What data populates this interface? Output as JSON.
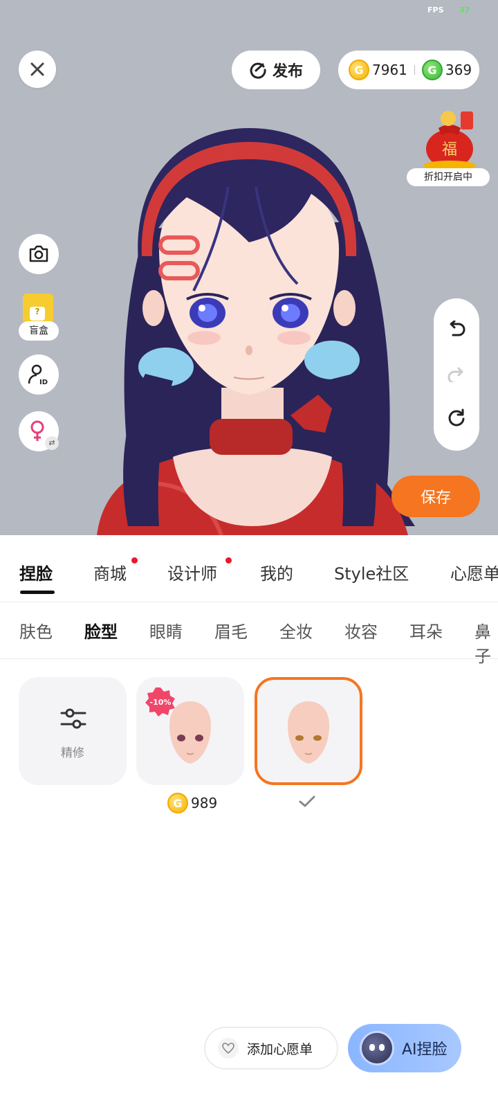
{
  "status": {
    "fps_label": "FPS",
    "fps_value": "37"
  },
  "header": {
    "publish_label": "发布",
    "gold_amount": "7961",
    "green_amount": "369",
    "gold_coin_symbol": "G",
    "green_coin_symbol": "G"
  },
  "promo": {
    "label": "折扣开启中",
    "bag_character": "福"
  },
  "sidebar": {
    "blindbox_label": "盲盒",
    "blindbox_symbol": "?"
  },
  "actions": {
    "save_label": "保存"
  },
  "main_tabs": [
    {
      "label": "捏脸",
      "active": true,
      "dot": false
    },
    {
      "label": "商城",
      "active": false,
      "dot": true
    },
    {
      "label": "设计师",
      "active": false,
      "dot": true
    },
    {
      "label": "我的",
      "active": false,
      "dot": false
    },
    {
      "label": "Style社区",
      "active": false,
      "dot": false
    },
    {
      "label": "心愿单",
      "active": false,
      "dot": false
    }
  ],
  "sub_tabs": [
    {
      "label": "肤色",
      "active": false
    },
    {
      "label": "脸型",
      "active": true
    },
    {
      "label": "眼睛",
      "active": false
    },
    {
      "label": "眉毛",
      "active": false
    },
    {
      "label": "全妆",
      "active": false
    },
    {
      "label": "妆容",
      "active": false
    },
    {
      "label": "耳朵",
      "active": false
    },
    {
      "label": "鼻子",
      "active": false
    }
  ],
  "items": [
    {
      "label": "精修"
    },
    {
      "badge": "-10%",
      "price": "989"
    },
    {
      "selected": true
    }
  ],
  "bottom": {
    "wishlist_label": "添加心愿单",
    "ai_label": "AI捏脸"
  },
  "colors": {
    "accent": "#f57520",
    "badge": "#f0466a",
    "dot": "#e8192c"
  }
}
